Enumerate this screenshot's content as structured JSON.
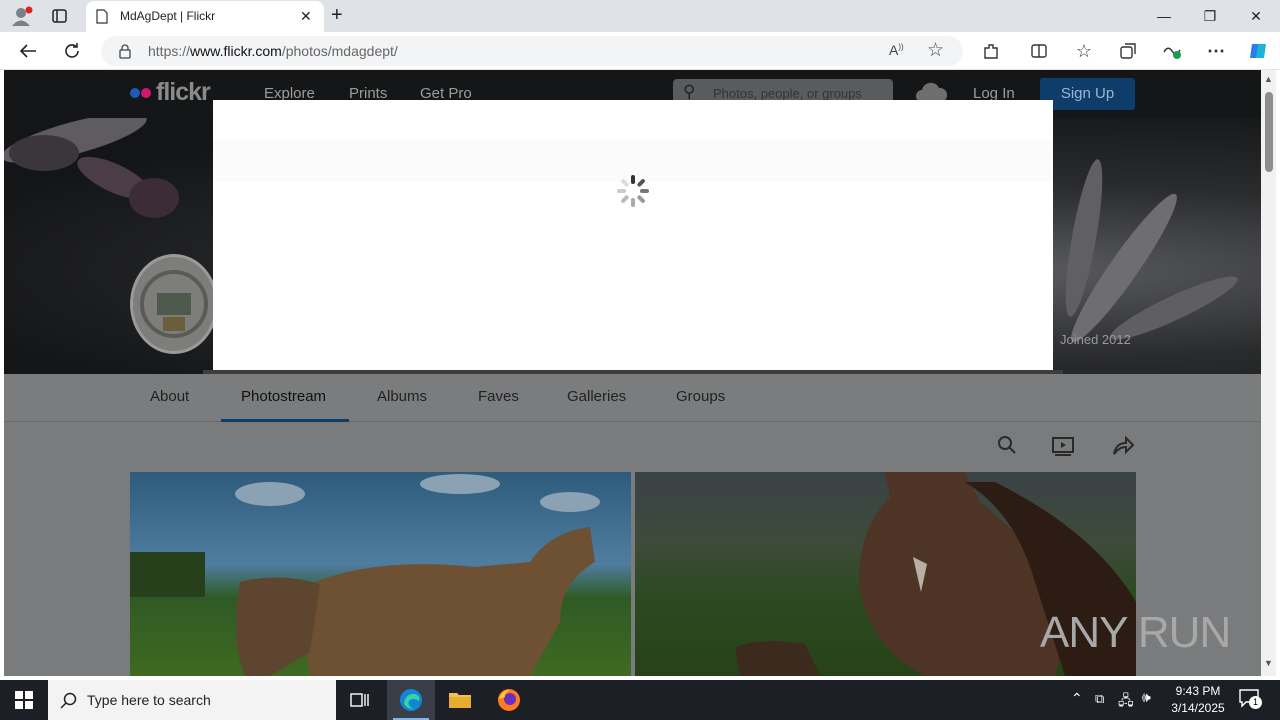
{
  "browser": {
    "tab_title": "MdAgDept | Flickr",
    "url_prefix": "https://",
    "url_domain": "www.flickr.com",
    "url_path": "/photos/mdagdept/"
  },
  "flickr": {
    "logo_text": "flickr",
    "nav": [
      "Explore",
      "Prints",
      "Get Pro"
    ],
    "search_placeholder": "Photos, people, or groups",
    "login": "Log In",
    "signup": "Sign Up",
    "joined": "Joined 2012",
    "tabs": [
      "About",
      "Photostream",
      "Albums",
      "Faves",
      "Galleries",
      "Groups"
    ],
    "active_tab": "Photostream",
    "accent": "#1c5d93"
  },
  "watermark": "ANY RUN",
  "taskbar": {
    "search_placeholder": "Type here to search",
    "time": "9:43 PM",
    "date": "3/14/2025",
    "notification_count": "1"
  }
}
